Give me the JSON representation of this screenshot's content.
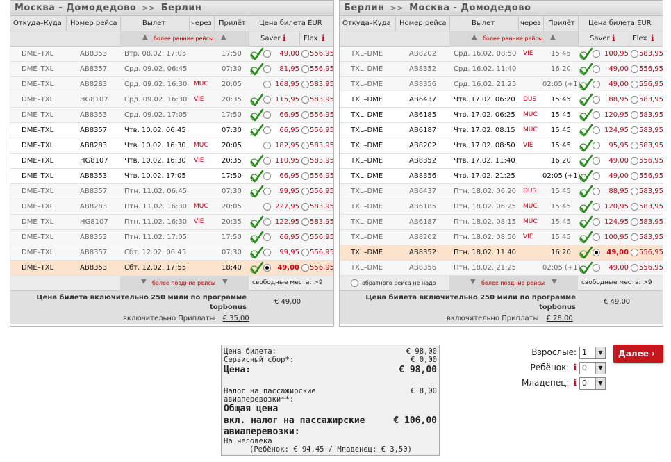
{
  "left": {
    "title_from": "Москва - Домодедово",
    "title_to": "Берлин",
    "arrow": ">>",
    "headers": {
      "route": "Откуда–Куда",
      "flight": "Номер рейса",
      "dep": "Вылет",
      "via": "через",
      "arr": "Прилёт",
      "price": "Цена билета EUR"
    },
    "earlier": "более ранние рейсы",
    "later": "более поздние рейсы",
    "saver": "Saver",
    "flex": "Flex",
    "info": "i",
    "seats": "свободные места: >9",
    "rows": [
      {
        "route": "DME–TXL",
        "flight": "AB8353",
        "dep": "Втр. 08.02.  17:05",
        "via": "",
        "arr": "17:50",
        "saver": "49,00",
        "flex": "556,95",
        "check": true,
        "sel": false,
        "dark": false
      },
      {
        "route": "DME–TXL",
        "flight": "AB8357",
        "dep": "Срд. 09.02.  06:45",
        "via": "",
        "arr": "07:30",
        "saver": "81,95",
        "flex": "556,95",
        "check": true,
        "sel": false,
        "dark": false
      },
      {
        "route": "DME–TXL",
        "flight": "AB8283",
        "dep": "Срд. 09.02.  16:30",
        "via": "MUC",
        "arr": "20:05",
        "saver": "168,95",
        "flex": "583,95",
        "check": false,
        "sel": false,
        "dark": false
      },
      {
        "route": "DME–TXL",
        "flight": "HG8107",
        "dep": "Срд. 09.02.  16:30",
        "via": "VIE",
        "arr": "20:35",
        "saver": "115,95",
        "flex": "583,95",
        "check": true,
        "sel": false,
        "dark": false
      },
      {
        "route": "DME–TXL",
        "flight": "AB8353",
        "dep": "Срд. 09.02.  17:05",
        "via": "",
        "arr": "17:50",
        "saver": "66,95",
        "flex": "556,95",
        "check": true,
        "sel": false,
        "dark": false
      },
      {
        "route": "DME–TXL",
        "flight": "AB8357",
        "dep": "Чтв. 10.02.  06:45",
        "via": "",
        "arr": "07:30",
        "saver": "66,95",
        "flex": "556,95",
        "check": true,
        "sel": false,
        "dark": true
      },
      {
        "route": "DME–TXL",
        "flight": "AB8283",
        "dep": "Чтв. 10.02.  16:30",
        "via": "MUC",
        "arr": "20:05",
        "saver": "182,95",
        "flex": "583,95",
        "check": false,
        "sel": false,
        "dark": true
      },
      {
        "route": "DME–TXL",
        "flight": "HG8107",
        "dep": "Чтв. 10.02.  16:30",
        "via": "VIE",
        "arr": "20:35",
        "saver": "110,95",
        "flex": "583,95",
        "check": true,
        "sel": false,
        "dark": true
      },
      {
        "route": "DME–TXL",
        "flight": "AB8353",
        "dep": "Чтв. 10.02.  17:05",
        "via": "",
        "arr": "17:50",
        "saver": "66,95",
        "flex": "556,95",
        "check": true,
        "sel": false,
        "dark": true
      },
      {
        "route": "DME–TXL",
        "flight": "AB8357",
        "dep": "Птн. 11.02.  06:45",
        "via": "",
        "arr": "07:30",
        "saver": "99,95",
        "flex": "556,95",
        "check": true,
        "sel": false,
        "dark": false
      },
      {
        "route": "DME–TXL",
        "flight": "AB8283",
        "dep": "Птн. 11.02.  16:30",
        "via": "MUC",
        "arr": "20:05",
        "saver": "227,95",
        "flex": "583,95",
        "check": false,
        "sel": false,
        "dark": false
      },
      {
        "route": "DME–TXL",
        "flight": "HG8107",
        "dep": "Птн. 11.02.  16:30",
        "via": "VIE",
        "arr": "20:35",
        "saver": "122,95",
        "flex": "583,95",
        "check": true,
        "sel": false,
        "dark": false
      },
      {
        "route": "DME–TXL",
        "flight": "AB8353",
        "dep": "Птн. 11.02.  17:05",
        "via": "",
        "arr": "17:50",
        "saver": "66,95",
        "flex": "556,95",
        "check": true,
        "sel": false,
        "dark": false
      },
      {
        "route": "DME–TXL",
        "flight": "AB8357",
        "dep": "Сбт. 12.02.  06:45",
        "via": "",
        "arr": "07:30",
        "saver": "99,95",
        "flex": "556,95",
        "check": true,
        "sel": false,
        "dark": false
      },
      {
        "route": "DME–TXL",
        "flight": "AB8353",
        "dep": "Сбт. 12.02.  17:55",
        "via": "",
        "arr": "18:40",
        "saver": "49,00",
        "flex": "556,95",
        "check": true,
        "sel": true,
        "dark": true
      }
    ],
    "bonus_l1": "Цена билета включительно 250 мили по программе",
    "bonus_l2": "topbonus",
    "bonus_val": "€ 49,00",
    "surcharge_label": "включительно Приплаты",
    "surcharge_val": "€ 35,00"
  },
  "right": {
    "title_from": "Берлин",
    "title_to": "Москва - Домодедово",
    "arrow": ">>",
    "headers": {
      "route": "Откуда–Куда",
      "flight": "Номер рейса",
      "dep": "Вылет",
      "via": "через",
      "arr": "Прилёт",
      "price": "Цена билета EUR"
    },
    "earlier": "более ранние рейсы",
    "later": "более поздние рейсы",
    "no_return": "обратного рейса не надо",
    "saver": "Saver",
    "flex": "Flex",
    "info": "i",
    "seats": "свободные места: >9",
    "rows": [
      {
        "route": "TXL–DME",
        "flight": "AB8202",
        "dep": "Срд. 16.02.  08:50",
        "via": "VIE",
        "arr": "15:45",
        "saver": "100,95",
        "flex": "583,95",
        "check": true,
        "sel": false,
        "dark": false
      },
      {
        "route": "TXL–DME",
        "flight": "AB8352",
        "dep": "Срд. 16.02.  11:40",
        "via": "",
        "arr": "16:20",
        "saver": "49,00",
        "flex": "556,95",
        "check": true,
        "sel": false,
        "dark": false
      },
      {
        "route": "TXL–DME",
        "flight": "AB8356",
        "dep": "Срд. 16.02.  21:25",
        "via": "",
        "arr": "02:05 (+1)",
        "saver": "49,00",
        "flex": "556,95",
        "check": true,
        "sel": false,
        "dark": false
      },
      {
        "route": "TXL–DME",
        "flight": "AB6437",
        "dep": "Чтв. 17.02.  06:20",
        "via": "DUS",
        "arr": "15:45",
        "saver": "88,95",
        "flex": "583,95",
        "check": true,
        "sel": false,
        "dark": true
      },
      {
        "route": "TXL–DME",
        "flight": "AB6185",
        "dep": "Чтв. 17.02.  06:25",
        "via": "MUC",
        "arr": "15:45",
        "saver": "120,95",
        "flex": "583,95",
        "check": true,
        "sel": false,
        "dark": true
      },
      {
        "route": "TXL–DME",
        "flight": "AB6187",
        "dep": "Чтв. 17.02.  08:15",
        "via": "MUC",
        "arr": "15:45",
        "saver": "124,95",
        "flex": "583,95",
        "check": true,
        "sel": false,
        "dark": true
      },
      {
        "route": "TXL–DME",
        "flight": "AB8202",
        "dep": "Чтв. 17.02.  08:50",
        "via": "VIE",
        "arr": "15:45",
        "saver": "95,95",
        "flex": "583,95",
        "check": true,
        "sel": false,
        "dark": true
      },
      {
        "route": "TXL–DME",
        "flight": "AB8352",
        "dep": "Чтв. 17.02.  11:40",
        "via": "",
        "arr": "16:20",
        "saver": "49,00",
        "flex": "556,95",
        "check": true,
        "sel": false,
        "dark": true
      },
      {
        "route": "TXL–DME",
        "flight": "AB8356",
        "dep": "Чтв. 17.02.  21:25",
        "via": "",
        "arr": "02:05 (+1)",
        "saver": "49,00",
        "flex": "556,95",
        "check": true,
        "sel": false,
        "dark": true
      },
      {
        "route": "TXL–DME",
        "flight": "AB6437",
        "dep": "Птн. 18.02.  06:20",
        "via": "DUS",
        "arr": "15:45",
        "saver": "88,95",
        "flex": "583,95",
        "check": true,
        "sel": false,
        "dark": false
      },
      {
        "route": "TXL–DME",
        "flight": "AB6185",
        "dep": "Птн. 18.02.  06:25",
        "via": "MUC",
        "arr": "15:45",
        "saver": "120,95",
        "flex": "583,95",
        "check": true,
        "sel": false,
        "dark": false
      },
      {
        "route": "TXL–DME",
        "flight": "AB6187",
        "dep": "Птн. 18.02.  08:15",
        "via": "MUC",
        "arr": "15:45",
        "saver": "124,95",
        "flex": "583,95",
        "check": true,
        "sel": false,
        "dark": false
      },
      {
        "route": "TXL–DME",
        "flight": "AB8202",
        "dep": "Птн. 18.02.  08:50",
        "via": "VIE",
        "arr": "15:45",
        "saver": "100,95",
        "flex": "583,95",
        "check": true,
        "sel": false,
        "dark": false
      },
      {
        "route": "TXL–DME",
        "flight": "AB8352",
        "dep": "Птн. 18.02.  11:40",
        "via": "",
        "arr": "16:20",
        "saver": "49,00",
        "flex": "556,95",
        "check": true,
        "sel": true,
        "dark": true
      },
      {
        "route": "TXL–DME",
        "flight": "AB8356",
        "dep": "Птн. 18.02.  21:25",
        "via": "",
        "arr": "02:05 (+1)",
        "saver": "49,00",
        "flex": "556,95",
        "check": true,
        "sel": false,
        "dark": false
      }
    ],
    "bonus_l1": "Цена билета включительно 250 мили по программе",
    "bonus_l2": "topbonus",
    "bonus_val": "€ 49,00",
    "surcharge_label": "включительно Приплаты",
    "surcharge_val": "€ 28,00"
  },
  "summary": {
    "ticket_label": "Цена билета:",
    "ticket_val": "€ 98,00",
    "service_label": "Сервисный сбор*:",
    "service_val": "€ 0,00",
    "price_label": "Цена:",
    "price_val": "€ 98,00",
    "tax_label_1": "Налог на пассажирские",
    "tax_label_2": "авиаперевозки**:",
    "tax_val": "€ 8,00",
    "total_1": "Общая цена",
    "total_2": "вкл. налог на пассажирские",
    "total_3": "авиаперевозки:",
    "total_val": "€ 106,00",
    "per_person": "На человека",
    "child_infant": "(Ребёнок: € 94,45 / Младенец: € 3,50)"
  },
  "pax": {
    "adults_label": "Взрослые:",
    "adults_val": "1",
    "child_label": "Ребёнок:",
    "child_val": "0",
    "infant_label": "Младенец:",
    "infant_val": "0",
    "info": "i"
  },
  "next_button": "Далее ›",
  "colors": {
    "accent": "#c4161c",
    "selected_row": "#fde3cc"
  }
}
